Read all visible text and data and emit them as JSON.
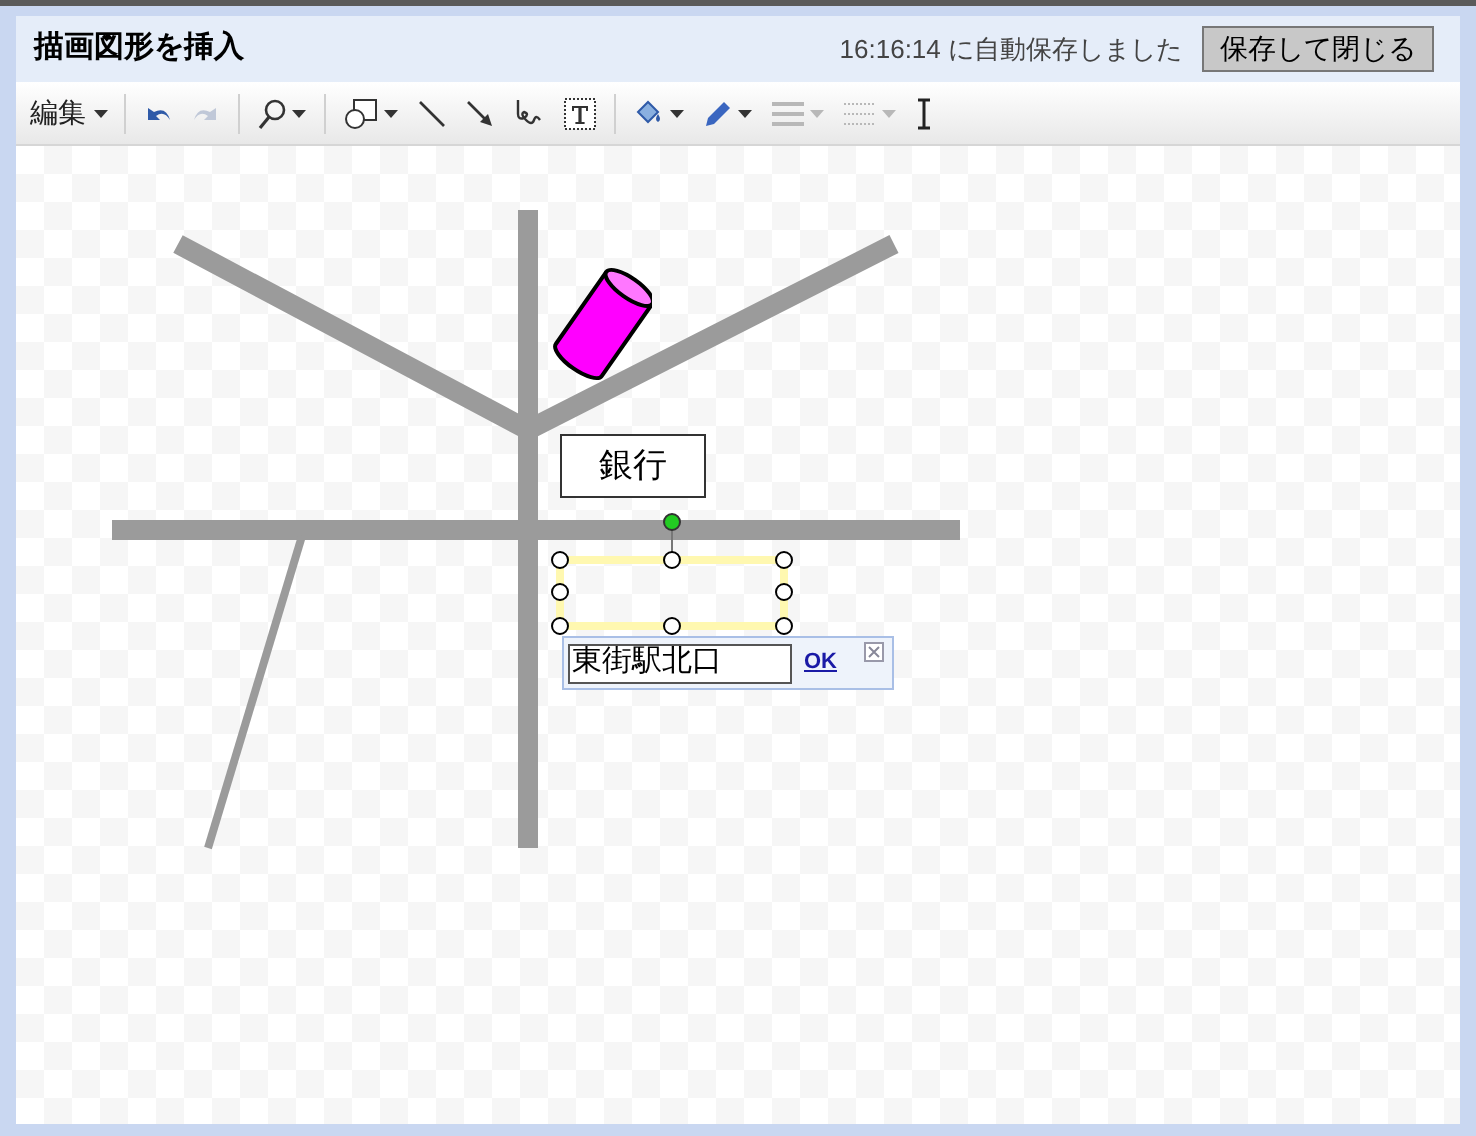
{
  "window": {
    "title": "描画図形を挿入",
    "autosave": "16:16:14 に自動保存しました",
    "save_button": "保存して閉じる"
  },
  "toolbar": [
    {
      "kind": "menu",
      "label": "編集",
      "disabled": false
    },
    {
      "kind": "separator"
    },
    {
      "kind": "undo",
      "disabled": false
    },
    {
      "kind": "redo",
      "disabled": true
    },
    {
      "kind": "separator"
    },
    {
      "kind": "zoom",
      "disabled": false
    },
    {
      "kind": "separator"
    },
    {
      "kind": "shape",
      "disabled": false
    },
    {
      "kind": "line",
      "disabled": false
    },
    {
      "kind": "arrow",
      "disabled": false
    },
    {
      "kind": "scribble",
      "disabled": false
    },
    {
      "kind": "textbox",
      "disabled": false
    },
    {
      "kind": "separator"
    },
    {
      "kind": "fill",
      "disabled": false
    },
    {
      "kind": "pen",
      "disabled": false
    },
    {
      "kind": "weight",
      "disabled": true
    },
    {
      "kind": "dash",
      "disabled": true
    },
    {
      "kind": "cursor",
      "disabled": false
    }
  ],
  "canvas": {
    "label": "銀行",
    "editor": {
      "value": "東街駅北口",
      "ok": "OK"
    }
  }
}
